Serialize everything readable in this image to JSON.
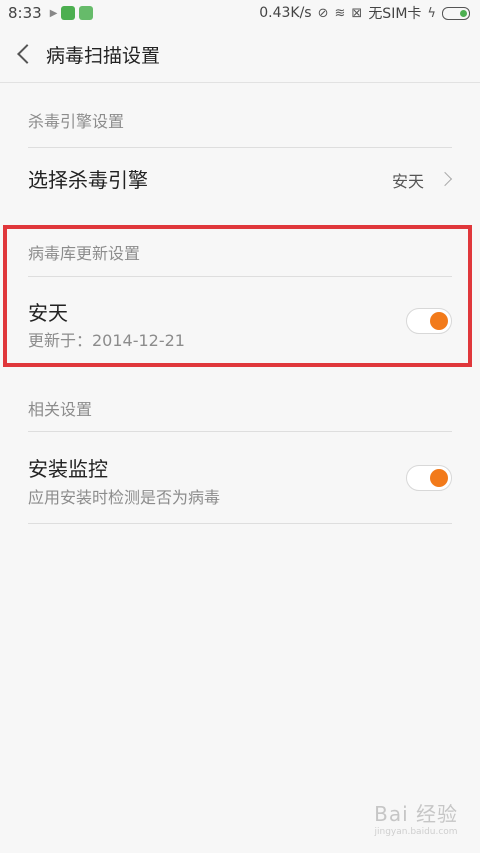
{
  "status": {
    "time": "8:33",
    "net_speed": "0.43K/s",
    "sim": "无SIM卡"
  },
  "header": {
    "title": "病毒扫描设置"
  },
  "sections": {
    "engine": {
      "label": "杀毒引擎设置",
      "row_title": "选择杀毒引擎",
      "row_value": "安天"
    },
    "db_update": {
      "label": "病毒库更新设置",
      "row_title": "安天",
      "row_sub": "更新于：2014-12-21",
      "toggle_on": true
    },
    "related": {
      "label": "相关设置",
      "row_title": "安装监控",
      "row_sub": "应用安装时检测是否为病毒",
      "toggle_on": true
    }
  },
  "colors": {
    "accent": "#f27a1a",
    "highlight": "#e0373b"
  },
  "watermark": {
    "text": "Bai 经验",
    "sub": "jingyan.baidu.com"
  }
}
